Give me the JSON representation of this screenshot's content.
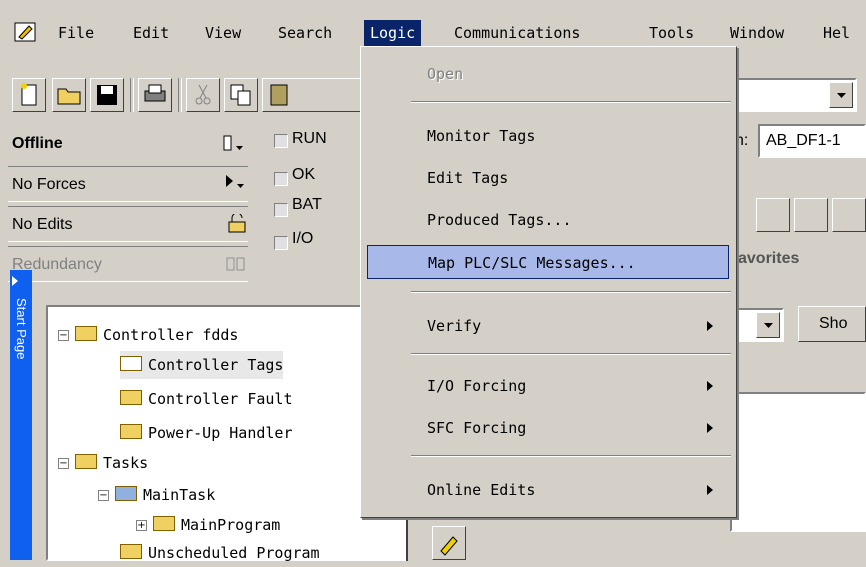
{
  "menubar": {
    "items": [
      {
        "label": "File"
      },
      {
        "label": "Edit"
      },
      {
        "label": "View"
      },
      {
        "label": "Search"
      },
      {
        "label": "Logic"
      },
      {
        "label": "Communications"
      },
      {
        "label": "Tools"
      },
      {
        "label": "Window"
      },
      {
        "label": "Hel"
      }
    ]
  },
  "status": {
    "mode": "Offline",
    "forces": "No Forces",
    "edits": "No Edits",
    "redundancy": "Redundancy",
    "indicators": [
      "RUN",
      "OK",
      "BAT",
      "I/O"
    ]
  },
  "path": {
    "label_fragment": "n:",
    "value": "AB_DF1-1"
  },
  "favorites_tab": "avorites",
  "show_button": "Sho",
  "start_page_tab": "Start Page",
  "tree": {
    "items": [
      {
        "label": "Controller fdds"
      },
      {
        "label": "Controller Tags"
      },
      {
        "label": "Controller Fault"
      },
      {
        "label": "Power-Up Handler"
      },
      {
        "label": "Tasks"
      },
      {
        "label": "MainTask"
      },
      {
        "label": "MainProgram"
      },
      {
        "label": "Unscheduled Program"
      }
    ]
  },
  "logic_menu": {
    "items": [
      {
        "label": "Open",
        "enabled": false
      },
      {
        "label": "Monitor Tags"
      },
      {
        "label": "Edit Tags"
      },
      {
        "label": "Produced Tags..."
      },
      {
        "label": "Map PLC/SLC Messages...",
        "highlighted": true
      },
      {
        "label": "Verify",
        "submenu": true
      },
      {
        "label": "I/O Forcing",
        "submenu": true
      },
      {
        "label": "SFC Forcing",
        "submenu": true
      },
      {
        "label": "Online Edits",
        "submenu": true
      }
    ]
  },
  "colors": {
    "menu_highlight": "#0a246a",
    "item_highlight": "#a8b8e8",
    "start_page_tab": "#1060f0",
    "face": "#d4d0c8"
  }
}
